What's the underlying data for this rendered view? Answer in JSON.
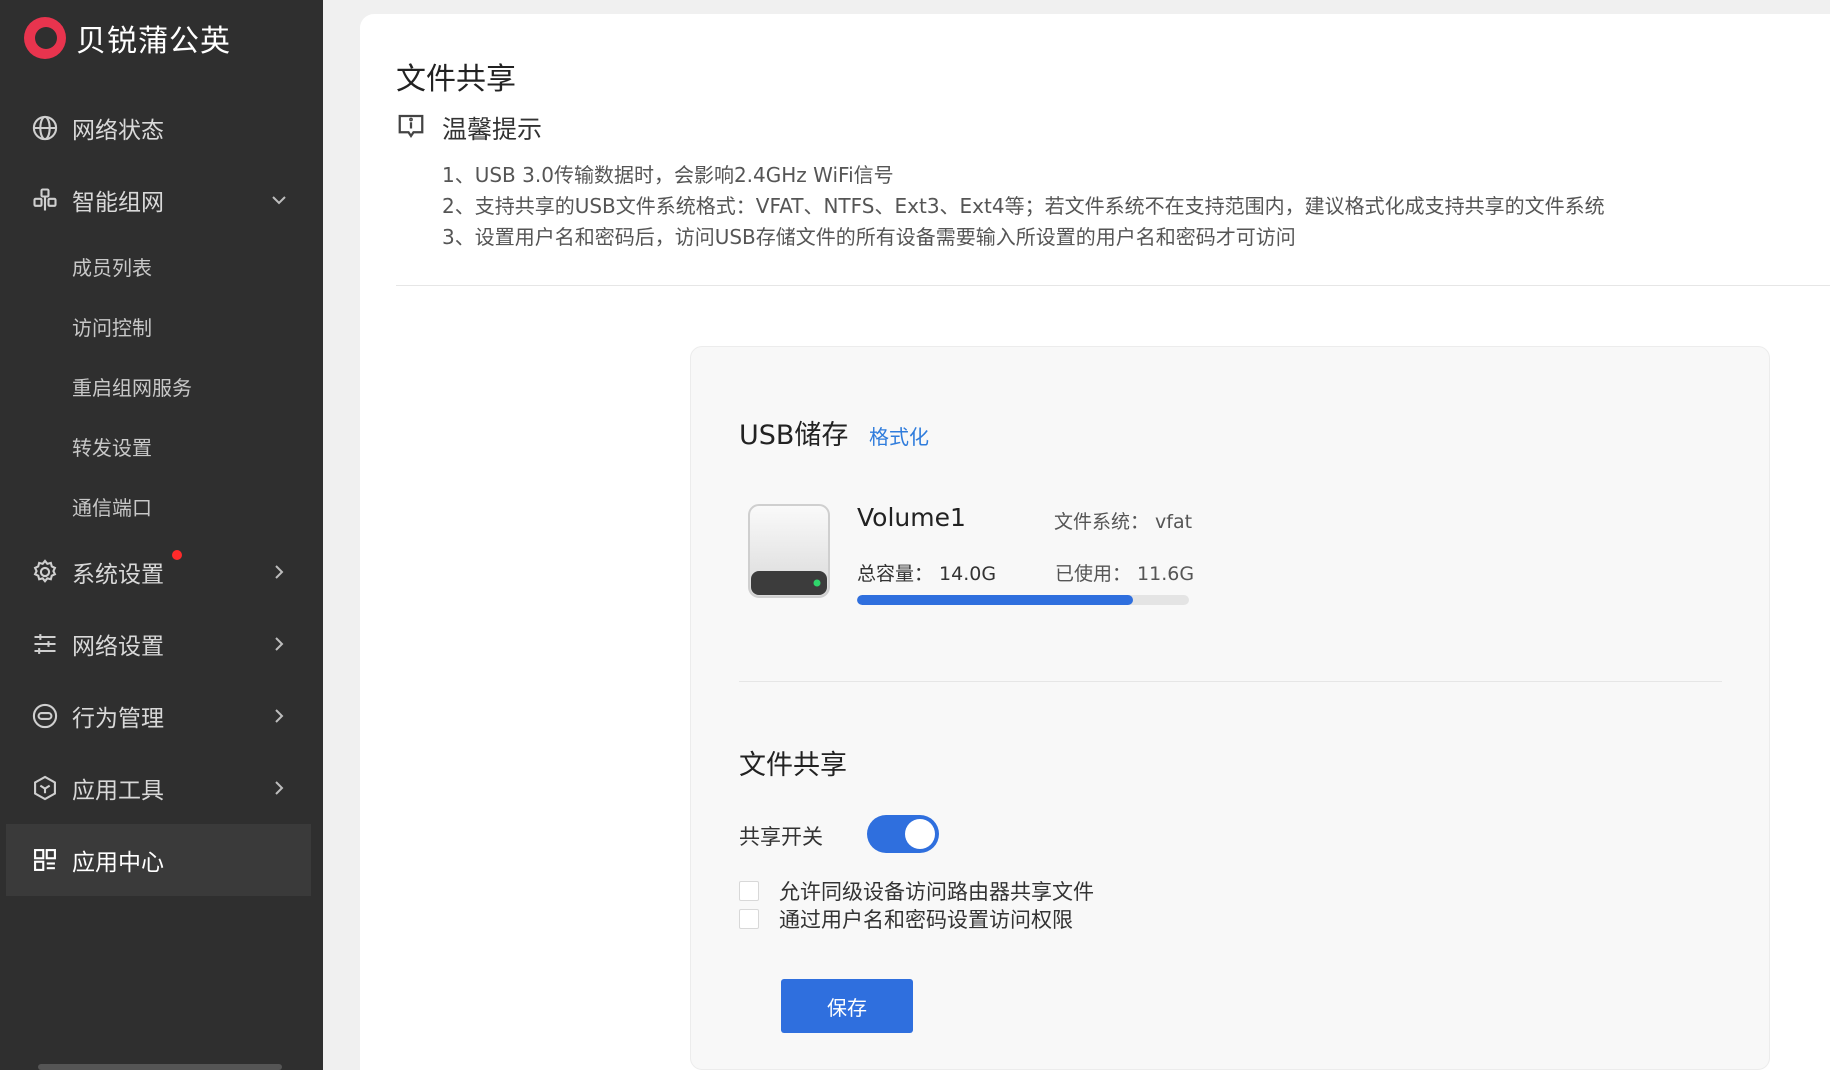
{
  "brand": {
    "name": "贝锐蒲公英"
  },
  "sidebar": {
    "items": [
      {
        "label": "网络状态"
      },
      {
        "label": "智能组网",
        "expanded": true,
        "children": [
          {
            "label": "成员列表"
          },
          {
            "label": "访问控制"
          },
          {
            "label": "重启组网服务"
          },
          {
            "label": "转发设置"
          },
          {
            "label": "通信端口"
          }
        ]
      },
      {
        "label": "系统设置"
      },
      {
        "label": "网络设置"
      },
      {
        "label": "行为管理"
      },
      {
        "label": "应用工具"
      },
      {
        "label": "应用中心"
      }
    ]
  },
  "page": {
    "title": "文件共享",
    "tip_title": "温馨提示",
    "tips": [
      "1、USB 3.0传输数据时，会影响2.4GHz WiFi信号",
      "2、支持共享的USB文件系统格式：VFAT、NTFS、Ext3、Ext4等；若文件系统不在支持范围内，建议格式化成支持共享的文件系统",
      "3、设置用户名和密码后，访问USB存储文件的所有设备需要输入所设置的用户名和密码才可访问"
    ]
  },
  "usb": {
    "title": "USB储存",
    "format_label": "格式化",
    "volume_name": "Volume1",
    "filesystem": "文件系统：  vfat",
    "total": "总容量：  14.0G",
    "used": "已使用：  11.6G",
    "used_fraction": 0.83
  },
  "share": {
    "title": "文件共享",
    "switch_label": "共享开关",
    "switch_on": true,
    "options": [
      "允许同级设备访问路由器共享文件",
      "通过用户名和密码设置访问权限"
    ],
    "save_label": "保存"
  },
  "colors": {
    "accent": "#2f6fde",
    "sidebar_bg": "#2f2f2f",
    "logo": "#e8344e",
    "link": "#2f7cdc"
  }
}
